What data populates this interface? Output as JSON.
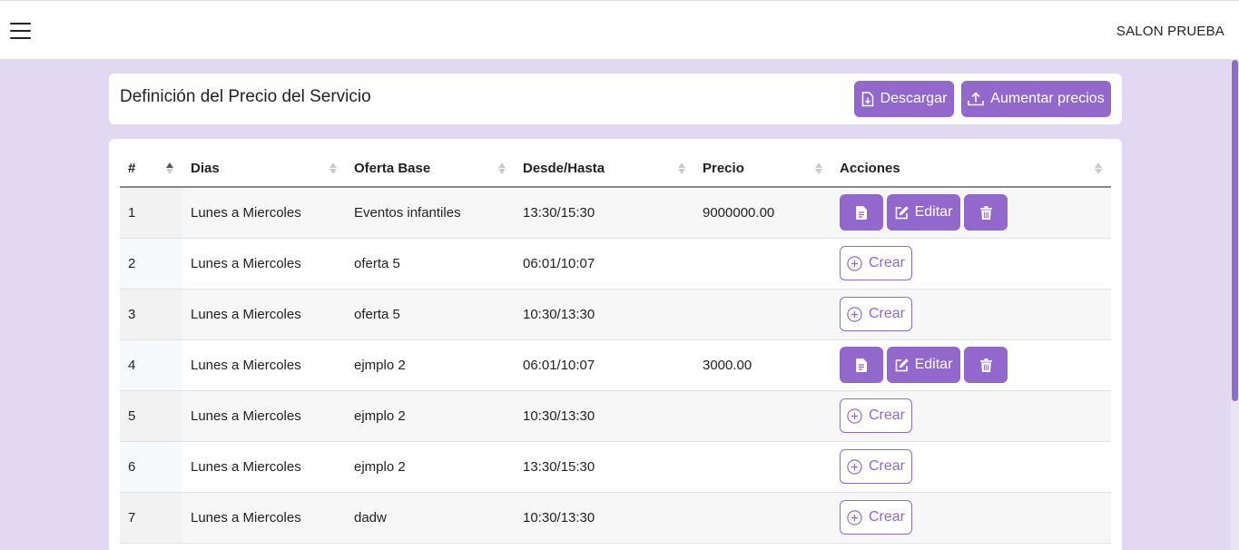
{
  "topbar": {
    "brand": "SALON PRUEBA"
  },
  "header": {
    "title": "Definición del Precio del Servicio",
    "download_label": "Descargar",
    "increase_label": "Aumentar precios"
  },
  "table": {
    "columns": [
      "#",
      "Dias",
      "Oferta Base",
      "Desde/Hasta",
      "Precio",
      "Acciones"
    ],
    "edit_label": "Editar",
    "create_label": "Crear",
    "rows": [
      {
        "num": "1",
        "dias": "Lunes a Miercoles",
        "oferta": "Eventos infantiles",
        "horario": "13:30/15:30",
        "precio": "9000000.00",
        "accion": "edit"
      },
      {
        "num": "2",
        "dias": "Lunes a Miercoles",
        "oferta": "oferta 5",
        "horario": "06:01/10:07",
        "precio": "",
        "accion": "create"
      },
      {
        "num": "3",
        "dias": "Lunes a Miercoles",
        "oferta": "oferta 5",
        "horario": "10:30/13:30",
        "precio": "",
        "accion": "create"
      },
      {
        "num": "4",
        "dias": "Lunes a Miercoles",
        "oferta": "ejmplo 2",
        "horario": "06:01/10:07",
        "precio": "3000.00",
        "accion": "edit"
      },
      {
        "num": "5",
        "dias": "Lunes a Miercoles",
        "oferta": "ejmplo 2",
        "horario": "10:30/13:30",
        "precio": "",
        "accion": "create"
      },
      {
        "num": "6",
        "dias": "Lunes a Miercoles",
        "oferta": "ejmplo 2",
        "horario": "13:30/15:30",
        "precio": "",
        "accion": "create"
      },
      {
        "num": "7",
        "dias": "Lunes a Miercoles",
        "oferta": "dadw",
        "horario": "10:30/13:30",
        "precio": "",
        "accion": "create"
      }
    ]
  },
  "colors": {
    "accent": "#9268cd",
    "background": "#e2d8f1"
  },
  "icons": [
    "menu-icon",
    "download-file-icon",
    "upload-icon",
    "sort-icon",
    "document-icon",
    "edit-icon",
    "trash-icon",
    "plus-circle-icon"
  ]
}
